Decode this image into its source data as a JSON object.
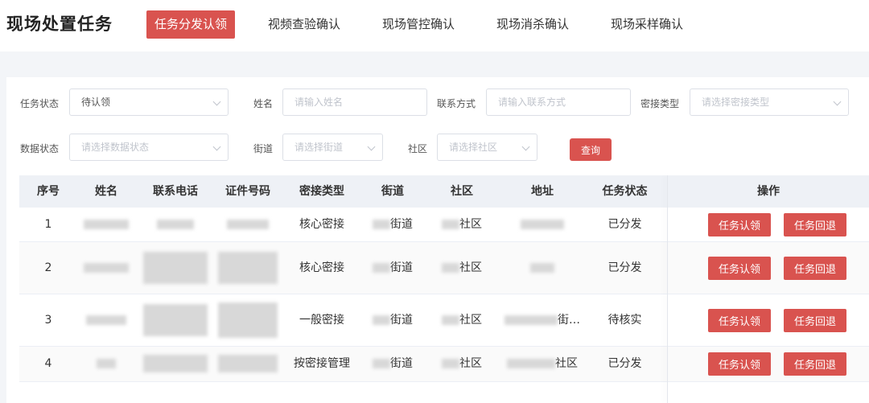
{
  "header": {
    "title": "现场处置任务",
    "tabs": [
      {
        "label": "任务分发认领",
        "active": true
      },
      {
        "label": "视频查验确认",
        "active": false
      },
      {
        "label": "现场管控确认",
        "active": false
      },
      {
        "label": "现场消杀确认",
        "active": false
      },
      {
        "label": "现场采样确认",
        "active": false
      }
    ]
  },
  "filters": {
    "task_status": {
      "label": "任务状态",
      "value": "待认领"
    },
    "name": {
      "label": "姓名",
      "placeholder": "请输入姓名"
    },
    "contact": {
      "label": "联系方式",
      "placeholder": "请输入联系方式"
    },
    "contact_type": {
      "label": "密接类型",
      "placeholder": "请选择密接类型"
    },
    "data_status": {
      "label": "数据状态",
      "placeholder": "请选择数据状态"
    },
    "street": {
      "label": "街道",
      "placeholder": "请选择街道"
    },
    "community": {
      "label": "社区",
      "placeholder": "请选择社区"
    },
    "query_label": "查询"
  },
  "table": {
    "columns": [
      "序号",
      "姓名",
      "联系电话",
      "证件号码",
      "密接类型",
      "街道",
      "社区",
      "地址",
      "任务状态",
      "操作"
    ],
    "rows": [
      {
        "index": "1",
        "type": "核心密接",
        "street_suffix": "街道",
        "community_suffix": "社区",
        "address_suffix": "",
        "status": "已分发"
      },
      {
        "index": "2",
        "type": "核心密接",
        "street_suffix": "街道",
        "community_suffix": "社区",
        "address_suffix": "",
        "status": "已分发"
      },
      {
        "index": "3",
        "type": "一般密接",
        "street_suffix": "街道",
        "community_suffix": "社区",
        "address_suffix": "街…",
        "status": "待核实"
      },
      {
        "index": "4",
        "type": "按密接管理",
        "street_suffix": "街道",
        "community_suffix": "社区",
        "address_suffix": "社区",
        "status": "已分发"
      }
    ],
    "claim_label": "任务认领",
    "return_label": "任务回退"
  },
  "colors": {
    "accent": "#d9534f"
  },
  "icons": {
    "select": "chevron-down-icon"
  }
}
